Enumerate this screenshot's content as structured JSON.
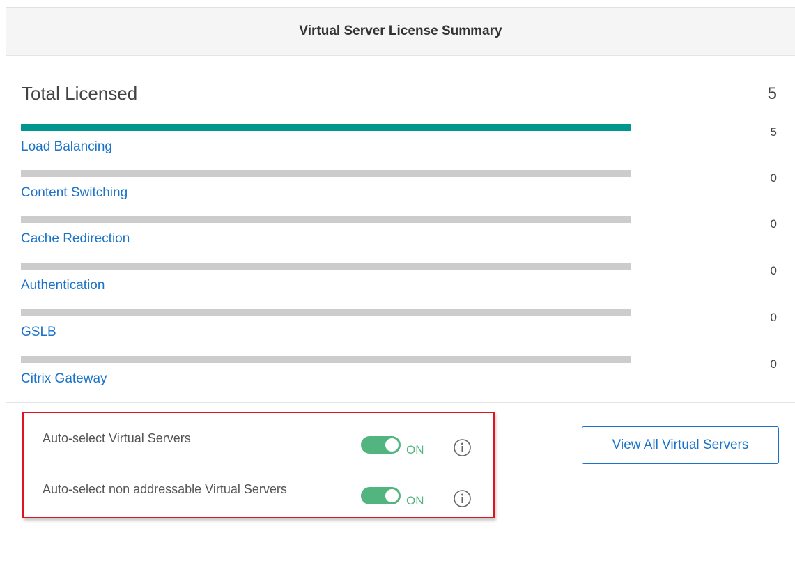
{
  "header": {
    "title": "Virtual Server License Summary"
  },
  "summary": {
    "total_label": "Total Licensed",
    "total_value": "5"
  },
  "license_rows": [
    {
      "label": "Load Balancing",
      "count": "5",
      "fill_fraction": 1.0
    },
    {
      "label": "Content Switching",
      "count": "0",
      "fill_fraction": 0.0
    },
    {
      "label": "Cache Redirection",
      "count": "0",
      "fill_fraction": 0.0
    },
    {
      "label": "Authentication",
      "count": "0",
      "fill_fraction": 0.0
    },
    {
      "label": "GSLB",
      "count": "0",
      "fill_fraction": 0.0
    },
    {
      "label": "Citrix Gateway",
      "count": "0",
      "fill_fraction": 0.0
    }
  ],
  "settings": {
    "auto_select": {
      "label": "Auto-select Virtual Servers",
      "state": "ON",
      "enabled": true,
      "icon": "info-icon"
    },
    "auto_select_non_addressable": {
      "label": "Auto-select non addressable Virtual Servers",
      "state": "ON",
      "enabled": true,
      "icon": "info-icon"
    }
  },
  "actions": {
    "view_all_label": "View All Virtual Servers"
  },
  "colors": {
    "bar_fill": "#00958f",
    "bar_track": "#cccccc",
    "link": "#1a73c8",
    "toggle_on": "#52b47e",
    "highlight_border": "#e0141e"
  }
}
